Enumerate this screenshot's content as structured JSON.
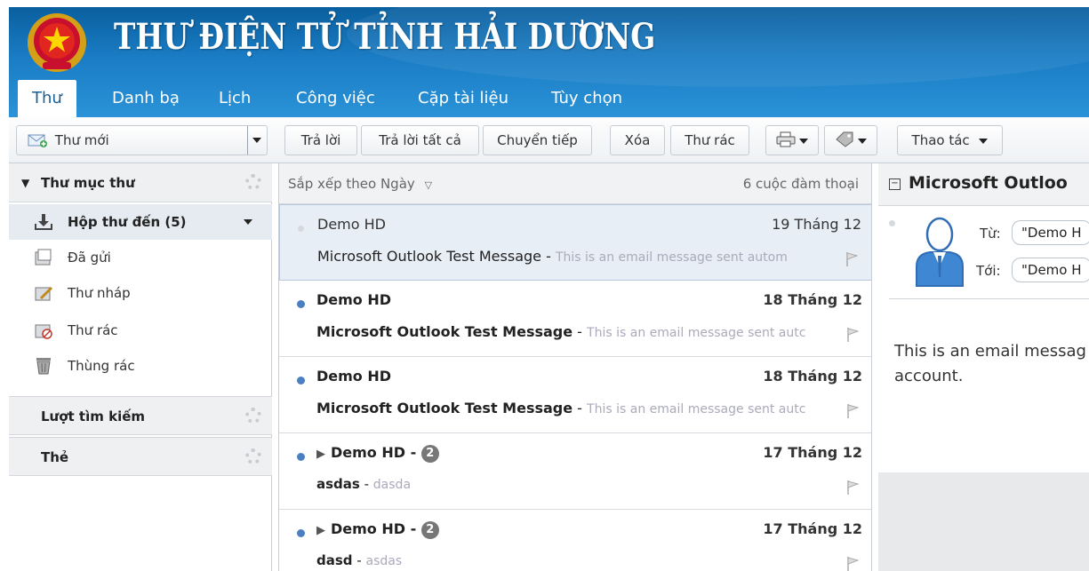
{
  "header": {
    "title": "THƯ ĐIỆN TỬ TỈNH HẢI DƯƠNG",
    "emblem_icon": "national-emblem-icon",
    "tabs": [
      {
        "label": "Thư",
        "active": true
      },
      {
        "label": "Danh bạ"
      },
      {
        "label": "Lịch"
      },
      {
        "label": "Công việc"
      },
      {
        "label": "Cặp tài liệu"
      },
      {
        "label": "Tùy chọn"
      }
    ]
  },
  "toolbar": {
    "new_mail": "Thư mới",
    "reply": "Trả lời",
    "reply_all": "Trả lời tất cả",
    "forward": "Chuyển tiếp",
    "delete": "Xóa",
    "spam": "Thư rác",
    "actions": "Thao tác"
  },
  "sidebar": {
    "folders_header": "Thư mục thư",
    "folders": [
      {
        "label": "Hộp thư đến (5)",
        "icon": "inbox-icon",
        "selected": true
      },
      {
        "label": "Đã gửi",
        "icon": "sent-icon"
      },
      {
        "label": "Thư nháp",
        "icon": "drafts-icon"
      },
      {
        "label": "Thư rác",
        "icon": "junk-icon"
      },
      {
        "label": "Thùng rác",
        "icon": "trash-icon"
      }
    ],
    "searches_header": "Lượt tìm kiếm",
    "tags_header": "Thẻ"
  },
  "message_list": {
    "sort_label": "Sắp xếp theo Ngày",
    "count_label": "6 cuộc đàm thoại",
    "messages": [
      {
        "sender": "Demo HD",
        "date": "19 Tháng 12",
        "subject": "Microsoft Outlook Test Message",
        "preview": "This is an email message sent autom",
        "read": true,
        "selected": true
      },
      {
        "sender": "Demo HD",
        "date": "18 Tháng 12",
        "subject": "Microsoft Outlook Test Message",
        "preview": "This is an email message sent autc",
        "read": false
      },
      {
        "sender": "Demo HD",
        "date": "18 Tháng 12",
        "subject": "Microsoft Outlook Test Message",
        "preview": "This is an email message sent autc",
        "read": false
      },
      {
        "sender": "Demo HD -",
        "date": "17 Tháng 12",
        "subject": "asdas",
        "preview": "dasda",
        "read": false,
        "count": "2"
      },
      {
        "sender": "Demo HD -",
        "date": "17 Tháng 12",
        "subject": "dasd",
        "preview": "asdas",
        "read": false,
        "count": "2"
      }
    ]
  },
  "reading_pane": {
    "subject": "Microsoft Outloo",
    "from_label": "Từ:",
    "from_value": "\"Demo H",
    "to_label": "Tới:",
    "to_value": "\"Demo H",
    "body_line1": "This is an email messag",
    "body_line2": "account."
  }
}
